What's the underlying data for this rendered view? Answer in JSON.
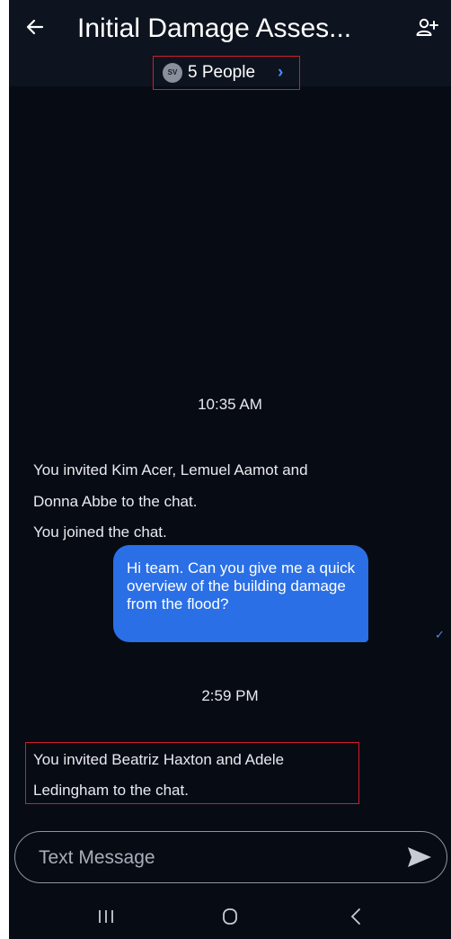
{
  "header": {
    "back_icon": "arrow-left-icon",
    "title": "Initial Damage Asses...",
    "add_person_icon": "add-person-icon",
    "participants": {
      "avatar_initials": "SV",
      "label": "5 People",
      "chevron": "›"
    }
  },
  "messages": {
    "timestamp_1": "10:35 AM",
    "system_1_line1": "You invited Kim Acer, Lemuel Aamot and",
    "system_1_line2": "Donna Abbe to the chat.",
    "system_2": "You joined the chat.",
    "outgoing_1": "Hi team. Can you give me a quick overview of the building damage from the flood?",
    "outgoing_1_status": "✓",
    "timestamp_2": "2:59 PM",
    "system_3_line1": "You invited Beatriz Haxton and Adele",
    "system_3_line2": "Ledingham to the chat."
  },
  "composer": {
    "placeholder": "Text Message",
    "send_icon": "send-icon"
  },
  "system_nav": {
    "recent_icon": "recent-apps-icon",
    "home_icon": "home-icon",
    "back_icon": "back-chevron-icon"
  },
  "colors": {
    "background": "#070b14",
    "header": "#0d131f",
    "bubble": "#2a6fe6",
    "accent": "#4a8bf5",
    "highlight": "#d41c2a"
  }
}
